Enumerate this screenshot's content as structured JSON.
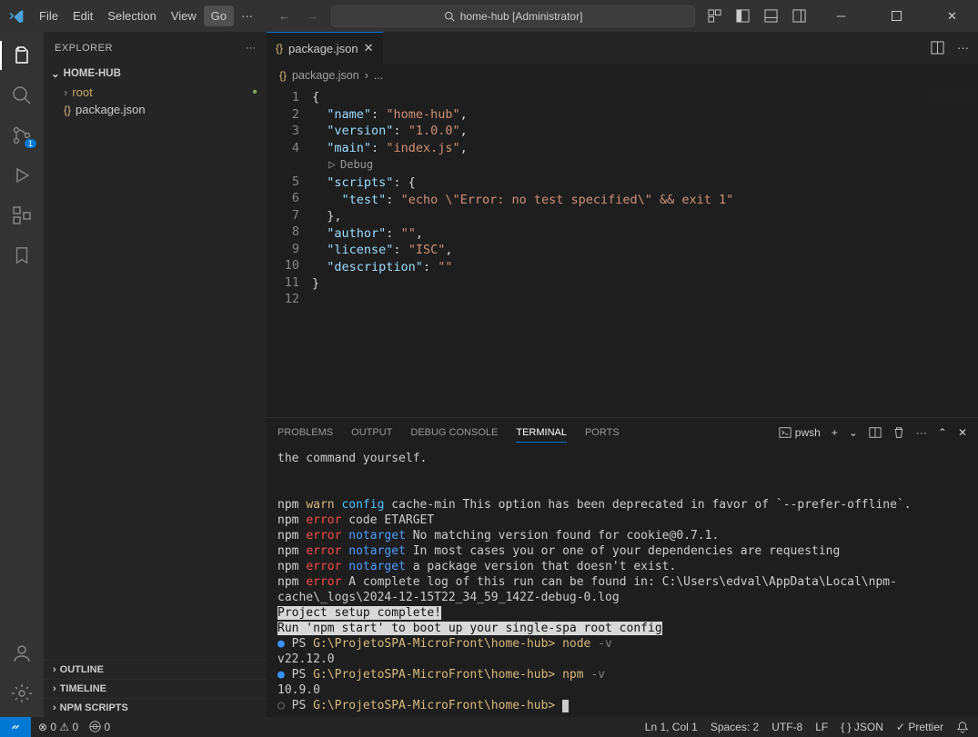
{
  "menubar": {
    "file": "File",
    "edit": "Edit",
    "selection": "Selection",
    "view": "View",
    "go": "Go"
  },
  "search": {
    "text": "home-hub [Administrator]"
  },
  "explorer": {
    "title": "EXPLORER",
    "root": "HOME-HUB",
    "tree": {
      "folder": "root",
      "file": "package.json"
    },
    "panels": {
      "outline": "OUTLINE",
      "timeline": "TIMELINE",
      "npm": "NPM SCRIPTS"
    }
  },
  "scm_badge": "1",
  "tab": {
    "name": "package.json"
  },
  "breadcrumb": {
    "file": "package.json",
    "more": "..."
  },
  "code": {
    "lines": [
      "1",
      "2",
      "3",
      "4",
      "",
      "5",
      "6",
      "7",
      "8",
      "9",
      "10",
      "11",
      "12"
    ],
    "l2_key": "\"name\"",
    "l2_val": "\"home-hub\"",
    "l3_key": "\"version\"",
    "l3_val": "\"1.0.0\"",
    "l4_key": "\"main\"",
    "l4_val": "\"index.js\"",
    "codelens": "Debug",
    "l5_key": "\"scripts\"",
    "l6_key": "\"test\"",
    "l6_val": "\"echo \\\"Error: no test specified\\\" && exit 1\"",
    "l8_key": "\"author\"",
    "l8_val": "\"\"",
    "l9_key": "\"license\"",
    "l9_val": "\"ISC\"",
    "l10_key": "\"description\"",
    "l10_val": "\"\""
  },
  "panel": {
    "tabs": {
      "problems": "PROBLEMS",
      "output": "OUTPUT",
      "debug": "DEBUG CONSOLE",
      "terminal": "TERMINAL",
      "ports": "PORTS"
    },
    "shell": "pwsh"
  },
  "terminal": {
    "l0": "the command yourself.",
    "l1_warn_cfg": "config",
    "l1_rest": " cache-min This option has been deprecated in favor of `--prefer-offline`.",
    "l2_rest": " code ETARGET",
    "l3_rest": " No matching version found for cookie@0.7.1.",
    "l4_rest": " In most cases you or one of your dependencies are requesting",
    "l5_rest": " a package version that doesn't exist.",
    "l6_rest": " A complete log of this run can be found in: C:\\Users\\edval\\AppData\\Local\\npm-cache\\_logs\\2024-12-15T22_34_59_142Z-debug-0.log",
    "hl1": "Project setup complete!",
    "hl2": "Run 'npm start' to boot up your single-spa root config",
    "ps_prefix": "PS ",
    "ps_path": "G:\\ProjetoSPA-MicroFront\\home-hub>",
    "cmd_node": "node",
    "cmd_npm": "npm",
    "arg_v": " -v",
    "node_ver": "v22.12.0",
    "npm_ver": "10.9.0",
    "npm": "npm ",
    "warn": "warn",
    "error": "error",
    "notarget": "notarget"
  },
  "status": {
    "errors": "0",
    "warnings": "0",
    "ports": "0",
    "lncol": "Ln 1, Col 1",
    "spaces": "Spaces: 2",
    "enc": "UTF-8",
    "eol": "LF",
    "lang": "JSON",
    "prettier": "Prettier"
  }
}
